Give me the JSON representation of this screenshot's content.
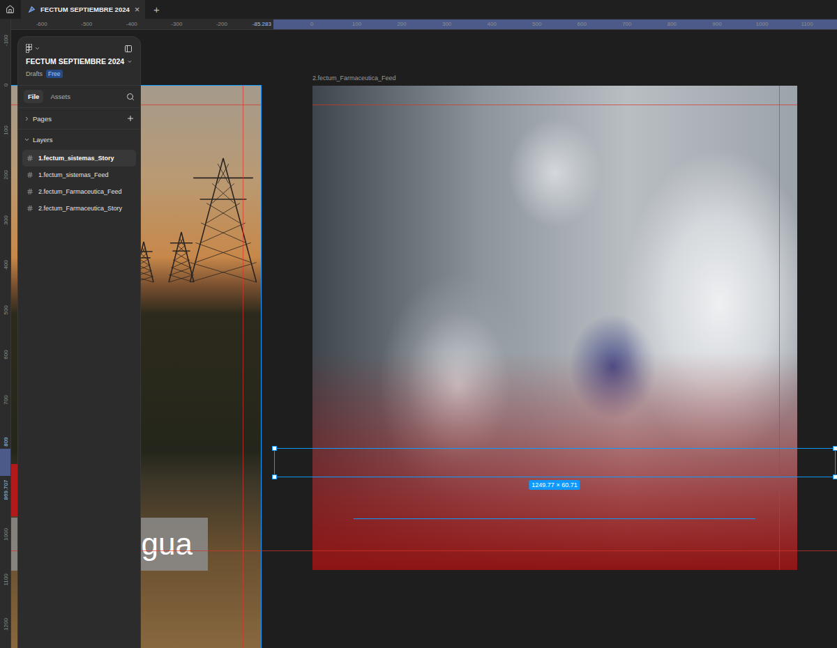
{
  "tabbar": {
    "tabs": [
      {
        "label": "FECTUM SEPTIEMBRE 2024",
        "selected": true,
        "close": "×"
      }
    ],
    "add": "+"
  },
  "rulers": {
    "top": [
      {
        "label": "-600",
        "selected": false
      },
      {
        "label": "-500",
        "selected": false
      },
      {
        "label": "-400",
        "selected": false
      },
      {
        "label": "-300",
        "selected": false
      },
      {
        "label": "-200",
        "selected": false
      },
      {
        "label": "-85.283",
        "selected": true
      },
      {
        "label": "0",
        "selected": false
      },
      {
        "label": "100",
        "selected": false
      },
      {
        "label": "200",
        "selected": false
      },
      {
        "label": "300",
        "selected": false
      },
      {
        "label": "400",
        "selected": false
      },
      {
        "label": "500",
        "selected": false
      },
      {
        "label": "600",
        "selected": false
      },
      {
        "label": "700",
        "selected": false
      },
      {
        "label": "800",
        "selected": false
      },
      {
        "label": "900",
        "selected": false
      },
      {
        "label": "1000",
        "selected": false
      },
      {
        "label": "1100",
        "selected": false
      }
    ],
    "left": [
      {
        "label": "-100",
        "selected": false
      },
      {
        "label": "0",
        "selected": false
      },
      {
        "label": "100",
        "selected": false
      },
      {
        "label": "200",
        "selected": false
      },
      {
        "label": "300",
        "selected": false
      },
      {
        "label": "400",
        "selected": false
      },
      {
        "label": "500",
        "selected": false
      },
      {
        "label": "600",
        "selected": false
      },
      {
        "label": "700",
        "selected": false
      },
      {
        "label": "809",
        "selected": true
      },
      {
        "label": "869.707",
        "selected": true
      },
      {
        "label": "1000",
        "selected": false
      },
      {
        "label": "1100",
        "selected": false
      },
      {
        "label": "1200",
        "selected": false
      }
    ]
  },
  "panel": {
    "file_name": "FECTUM SEPTIEMBRE 2024",
    "location": "Drafts",
    "plan": "Free",
    "tabs": [
      {
        "label": "File",
        "selected": true
      },
      {
        "label": "Assets",
        "selected": false
      }
    ],
    "pages": {
      "label": "Pages",
      "expanded": false
    },
    "layers": {
      "label": "Layers",
      "expanded": true,
      "items": [
        {
          "name": "1.fectum_sistemas_Story",
          "selected": true
        },
        {
          "name": "1.fectum_sistemas_Feed",
          "selected": false
        },
        {
          "name": "2.fectum_Farmaceutica_Feed",
          "selected": false
        },
        {
          "name": "2.fectum_Farmaceutica_Story",
          "selected": false
        }
      ]
    }
  },
  "canvas": {
    "story_frame": {
      "selected": true,
      "caption": "gua"
    },
    "feed_frame": {
      "label": "2.fectum_Farmaceutica_Feed"
    },
    "selection": {
      "size": "1249.77 × 60.71"
    }
  }
}
